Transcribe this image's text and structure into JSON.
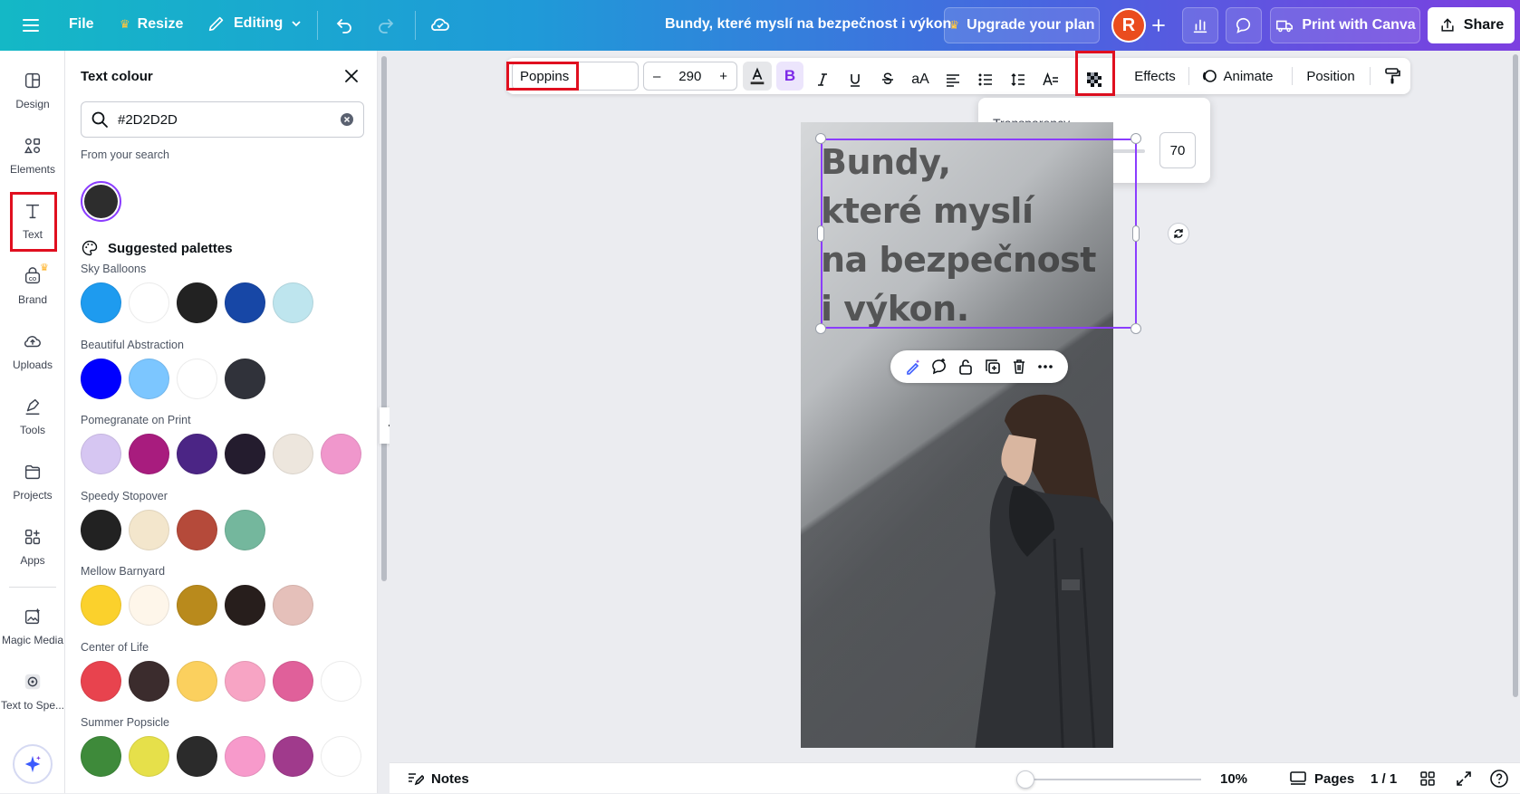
{
  "topbar": {
    "menu_icon": "hamburger-icon",
    "file_label": "File",
    "resize_label": "Resize",
    "editing_label": "Editing",
    "doc_title": "Bundy, které myslí na bezpečnost i výkon.",
    "upgrade_label": "Upgrade your plan",
    "avatar_letter": "R",
    "print_label": "Print with Canva",
    "share_label": "Share"
  },
  "rail": {
    "items": [
      {
        "label": "Design",
        "icon": "layout-icon"
      },
      {
        "label": "Elements",
        "icon": "shapes-icon"
      },
      {
        "label": "Text",
        "icon": "text-icon"
      },
      {
        "label": "Brand",
        "icon": "brand-icon"
      },
      {
        "label": "Uploads",
        "icon": "cloud-upload-icon"
      },
      {
        "label": "Tools",
        "icon": "pen-tool-icon"
      },
      {
        "label": "Projects",
        "icon": "folder-icon"
      },
      {
        "label": "Apps",
        "icon": "apps-grid-icon"
      },
      {
        "label": "Magic Media",
        "icon": "magic-media-icon"
      },
      {
        "label": "Text to Spe...",
        "icon": "text-to-speech-icon"
      }
    ]
  },
  "panel": {
    "title": "Text colour",
    "search_value": "#2D2D2D",
    "from_search_label": "From your search",
    "search_result_color": "#2D2D2D",
    "suggested_label": "Suggested palettes",
    "palettes": [
      {
        "name": "Sky Balloons",
        "colors": [
          "#1E9BEF",
          "#FFFFFF",
          "#222222",
          "#1747A6",
          "#BEE5EE"
        ]
      },
      {
        "name": "Beautiful Abstraction",
        "colors": [
          "#0000FF",
          "#7CC6FF",
          "#FFFFFF",
          "#30323A"
        ]
      },
      {
        "name": "Pomegranate on Print",
        "colors": [
          "#D6C6F2",
          "#A81C7E",
          "#4B2585",
          "#241C2E",
          "#EDE6DD",
          "#F097CC"
        ]
      },
      {
        "name": "Speedy Stopover",
        "colors": [
          "#222222",
          "#F3E6CC",
          "#B54A3A",
          "#74B79D"
        ]
      },
      {
        "name": "Mellow Barnyard",
        "colors": [
          "#FBD12C",
          "#FEF6EA",
          "#B98A1C",
          "#271E1C",
          "#E5C0BA"
        ]
      },
      {
        "name": "Center of Life",
        "colors": [
          "#E8434E",
          "#3B2C2D",
          "#FBD05E",
          "#F7A4C4",
          "#E0609A",
          "#FFFFFF"
        ]
      },
      {
        "name": "Summer Popsicle",
        "colors": [
          "#3E8A3A",
          "#E6E04A",
          "#2B2B2B",
          "#F79ACB",
          "#A03A8C",
          "#FFFFFF"
        ]
      }
    ]
  },
  "toolbar": {
    "font_name": "Poppins",
    "font_size": "290",
    "decrease_label": "–",
    "increase_label": "+",
    "effects_label": "Effects",
    "animate_label": "Animate",
    "position_label": "Position"
  },
  "transparency": {
    "label": "Transparency",
    "value": "70",
    "fraction": 0.7
  },
  "canvas": {
    "headline_lines": [
      "Bundy,",
      "které myslí",
      "na bezpečnost",
      "i výkon."
    ]
  },
  "bottombar": {
    "notes_label": "Notes",
    "zoom_label": "10%",
    "zoom_fraction": 0.02,
    "pages_label": "Pages",
    "page_count": "1 / 1"
  },
  "colors": {
    "accent": "#8B3DFF",
    "highlight": "#E00F1F",
    "text_color": "#2D2D2D"
  }
}
